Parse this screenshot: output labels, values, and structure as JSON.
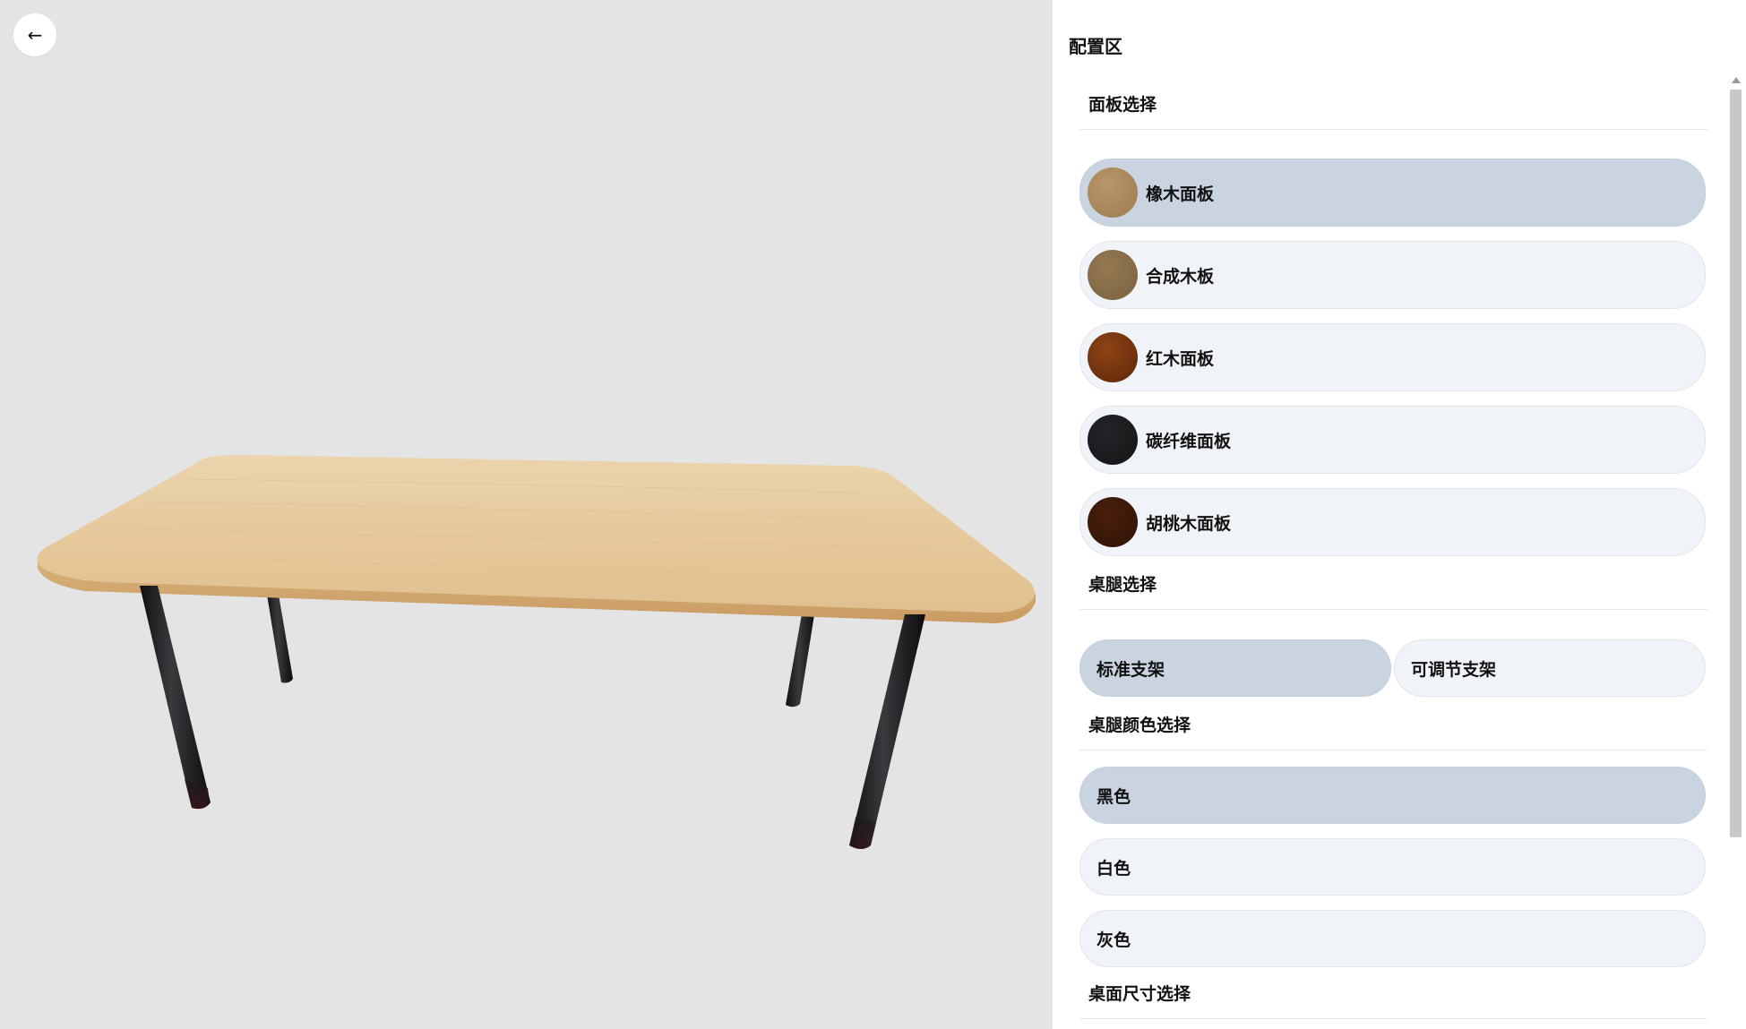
{
  "viewer": {
    "back_icon": "←"
  },
  "panel": {
    "title": "配置区",
    "sections": {
      "panel_select": {
        "title": "面板选择",
        "options": [
          {
            "label": "橡木面板",
            "swatch": "#a8875a",
            "selected": true
          },
          {
            "label": "合成木板",
            "swatch": "#8a6e48",
            "selected": false
          },
          {
            "label": "红木面板",
            "swatch": "#7a3510",
            "selected": false
          },
          {
            "label": "碳纤维面板",
            "swatch": "#1b1c1e",
            "selected": false
          },
          {
            "label": "胡桃木面板",
            "swatch": "#3a1a0a",
            "selected": false
          }
        ]
      },
      "leg_select": {
        "title": "桌腿选择",
        "options": [
          {
            "label": "标准支架",
            "selected": true
          },
          {
            "label": "可调节支架",
            "selected": false
          }
        ]
      },
      "leg_color": {
        "title": "桌腿颜色选择",
        "options": [
          {
            "label": "黑色",
            "selected": true
          },
          {
            "label": "白色",
            "selected": false
          },
          {
            "label": "灰色",
            "selected": false
          }
        ]
      },
      "top_size": {
        "title": "桌面尺寸选择"
      }
    }
  },
  "colors": {
    "selected_bg": "#cad4e1",
    "option_bg": "#f0f3f7",
    "viewer_bg": "#e4e4e4"
  }
}
